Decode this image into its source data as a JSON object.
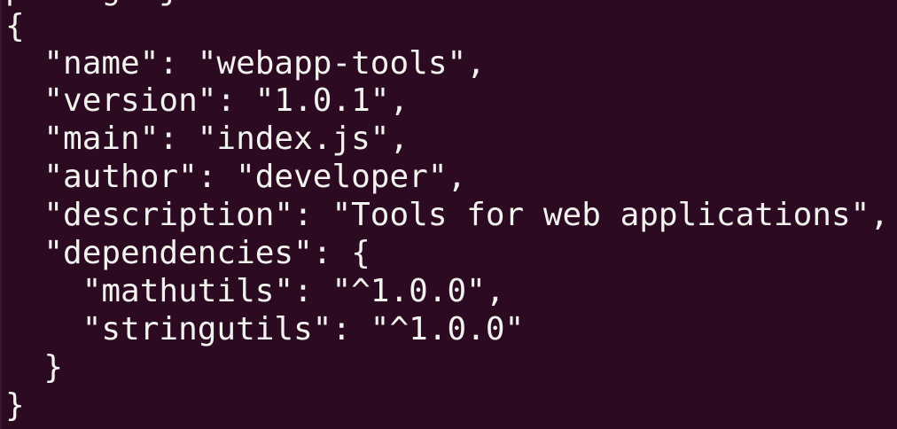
{
  "terminal": {
    "partial_top_line": "package.json",
    "lines": [
      "{",
      "  \"name\": \"webapp-tools\",",
      "  \"version\": \"1.0.1\",",
      "  \"main\": \"index.js\",",
      "  \"author\": \"developer\",",
      "  \"description\": \"Tools for web applications\",",
      "  \"dependencies\": {",
      "    \"mathutils\": \"^1.0.0\",",
      "    \"stringutils\": \"^1.0.0\"",
      "  }",
      "}"
    ],
    "colors": {
      "background": "#2c0a22",
      "text": "#f2f2ee"
    }
  }
}
